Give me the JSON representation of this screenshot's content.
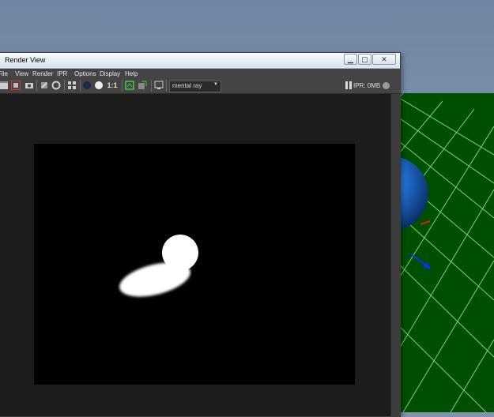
{
  "window": {
    "title": "Render View",
    "minimize_glyph": "▁",
    "maximize_glyph": "▢",
    "close_glyph": "✕"
  },
  "menu": [
    "File",
    "View",
    "Render",
    "IPR",
    "Options",
    "Display",
    "Help"
  ],
  "toolbar": {
    "ratio_label": "1:1",
    "renderer": "mental ray",
    "ipr_label": "IPR: 0MB"
  },
  "icons": {
    "render-icon": "clapboard",
    "region-icon": "region",
    "snapshot-icon": "camera",
    "ipr-icon": "ipr",
    "refresh-icon": "refresh",
    "options-icon": "settings",
    "color-channel-icon": "rgb",
    "alpha-icon": "alpha",
    "keep-image-icon": "keep",
    "remove-image-icon": "remove",
    "display-icon": "display"
  },
  "colors": {
    "ground": "#004d00",
    "grid": "#7fe07f",
    "sphere": "#1560c2",
    "sky": "#8094ab"
  }
}
